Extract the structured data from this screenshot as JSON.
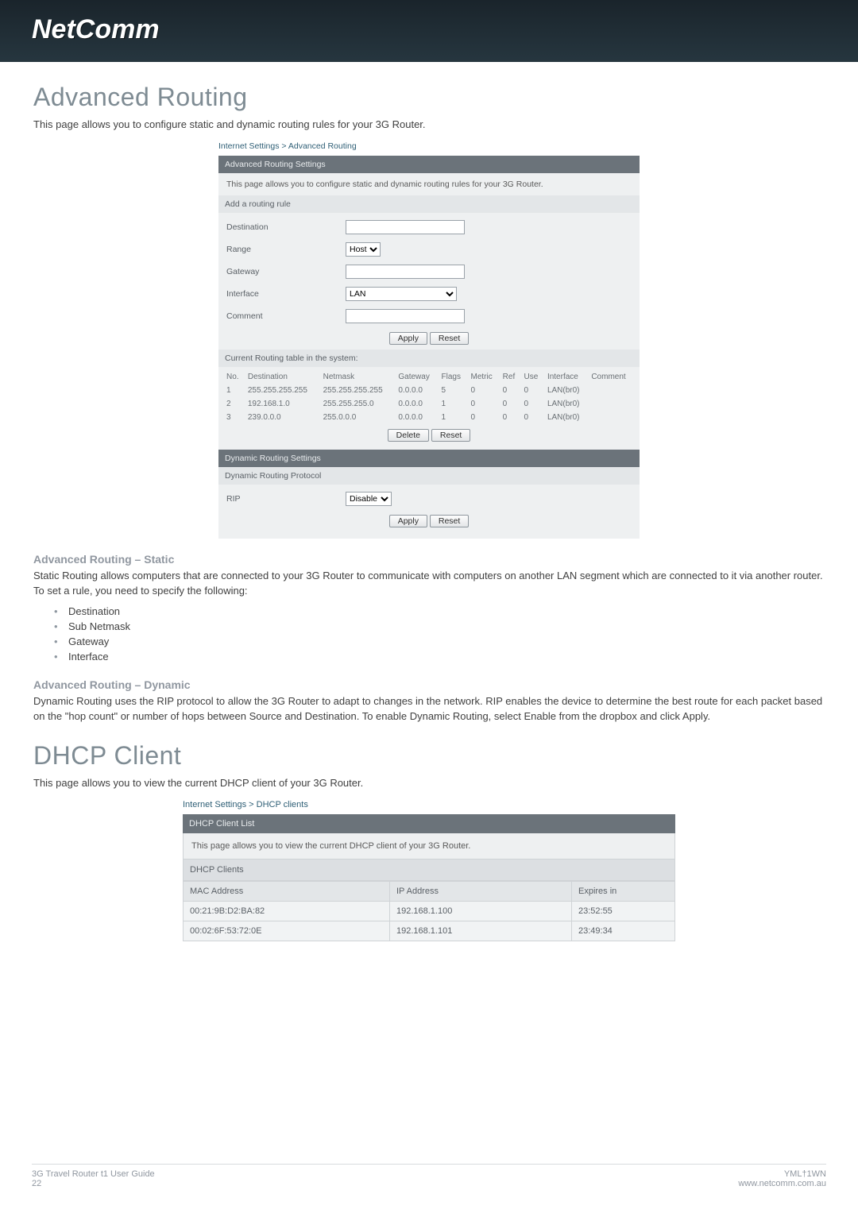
{
  "brand": "NetComm",
  "adv": {
    "title": "Advanced Routing",
    "intro": "This page allows you to configure static and dynamic routing rules for your 3G Router.",
    "crumb": "Internet Settings > Advanced Routing",
    "panel_title": "Advanced Routing Settings",
    "panel_desc": "This page allows you to configure static and dynamic routing rules for your 3G Router.",
    "add_label": "Add a routing rule",
    "dest_label": "Destination",
    "range_label": "Range",
    "range_value": "Host",
    "gateway_label": "Gateway",
    "interface_label": "Interface",
    "interface_value": "LAN",
    "comment_label": "Comment",
    "apply_btn": "Apply",
    "reset_btn": "Reset",
    "table_heading": "Current Routing table in the system:",
    "headers": {
      "no": "No.",
      "dest": "Destination",
      "netmask": "Netmask",
      "gateway": "Gateway",
      "flags": "Flags",
      "metric": "Metric",
      "ref": "Ref",
      "use": "Use",
      "iface": "Interface",
      "comment": "Comment"
    },
    "rows": [
      {
        "no": "1",
        "dest": "255.255.255.255",
        "netmask": "255.255.255.255",
        "gateway": "0.0.0.0",
        "flags": "5",
        "metric": "0",
        "ref": "0",
        "use": "0",
        "iface": "LAN(br0)",
        "comment": ""
      },
      {
        "no": "2",
        "dest": "192.168.1.0",
        "netmask": "255.255.255.0",
        "gateway": "0.0.0.0",
        "flags": "1",
        "metric": "0",
        "ref": "0",
        "use": "0",
        "iface": "LAN(br0)",
        "comment": ""
      },
      {
        "no": "3",
        "dest": "239.0.0.0",
        "netmask": "255.0.0.0",
        "gateway": "0.0.0.0",
        "flags": "1",
        "metric": "0",
        "ref": "0",
        "use": "0",
        "iface": "LAN(br0)",
        "comment": ""
      }
    ],
    "delete_btn": "Delete",
    "reset_btn2": "Reset",
    "dyn_bar": "Dynamic Routing Settings",
    "dyn_proto_label": "Dynamic Routing Protocol",
    "rip_label": "RIP",
    "rip_value": "Disable",
    "apply_btn2": "Apply",
    "reset_btn3": "Reset"
  },
  "static": {
    "heading": "Advanced Routing – Static",
    "body": "Static Routing allows computers that are connected to your 3G Router to communicate with computers on another LAN segment which are connected to it via another router. To set a rule, you need to specify the following:",
    "items": [
      "Destination",
      "Sub Netmask",
      "Gateway",
      "Interface"
    ]
  },
  "dynamic": {
    "heading": "Advanced Routing – Dynamic",
    "body": "Dynamic Routing uses the RIP protocol to allow the 3G Router to adapt to changes in the network. RIP enables the device to determine the best route for each packet based on the \"hop count\" or number of hops between Source and Destination. To enable Dynamic Routing, select Enable from the dropbox and click Apply."
  },
  "dhcp": {
    "title": "DHCP Client",
    "intro": "This page allows you to view the current DHCP client of your 3G Router.",
    "crumb": "Internet Settings > DHCP clients",
    "bar": "DHCP Client List",
    "desc": "This page allows you to view the current DHCP client of your 3G Router.",
    "clients_label": "DHCP Clients",
    "headers": {
      "mac": "MAC Address",
      "ip": "IP Address",
      "exp": "Expires in"
    },
    "rows": [
      {
        "mac": "00:21:9B:D2:BA:82",
        "ip": "192.168.1.100",
        "exp": "23:52:55"
      },
      {
        "mac": "00:02:6F:53:72:0E",
        "ip": "192.168.1.101",
        "exp": "23:49:34"
      }
    ]
  },
  "footer": {
    "left1": "3G Travel Router t1 User Guide",
    "left2": "22",
    "right1": "YML†1WN",
    "right2": "www.netcomm.com.au"
  }
}
